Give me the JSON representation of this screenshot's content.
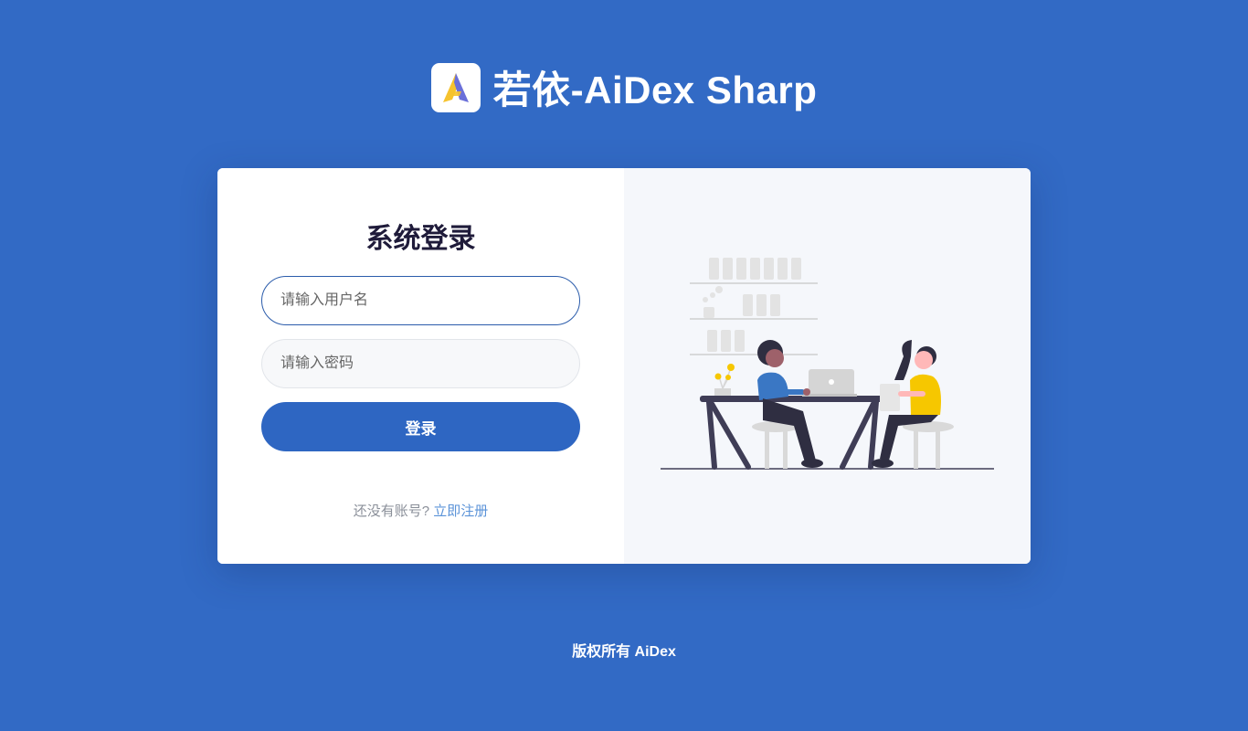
{
  "header": {
    "title": "若依-AiDex Sharp",
    "logo_icon": "aidex-logo-icon"
  },
  "login": {
    "title": "系统登录",
    "username_placeholder": "请输入用户名",
    "password_placeholder": "请输入密码",
    "submit_label": "登录",
    "no_account_text": "还没有账号?",
    "register_link": "立即注册"
  },
  "illustration": {
    "icon": "coworking-illustration"
  },
  "footer": {
    "copyright": "版权所有 AiDex"
  },
  "colors": {
    "background": "#326ac5",
    "primary_button": "#2e66c2",
    "link": "#5b93d8",
    "title_text": "#1f1b3a",
    "illustration_pane": "#f5f7fb"
  }
}
